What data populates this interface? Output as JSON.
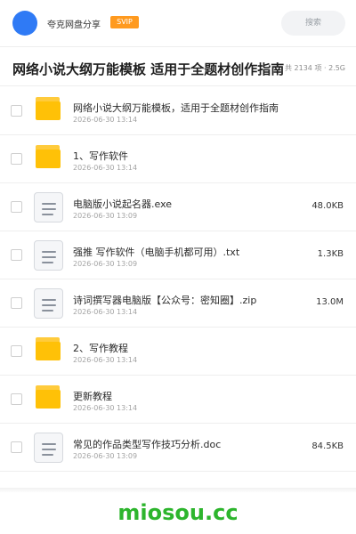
{
  "header": {
    "account_name": "夸克网盘分享",
    "badge": "SVIP",
    "search_placeholder": "搜索"
  },
  "page": {
    "title": "网络小说大纲万能模板 适用于全题材创作指南",
    "meta": "共 2134 项 · 2.5G"
  },
  "files": [
    {
      "type": "folder",
      "name": "网络小说大纲万能模板，适用于全题材创作指南",
      "date": "2026-06-30 13:14",
      "size": ""
    },
    {
      "type": "folder",
      "name": "1、写作软件",
      "date": "2026-06-30 13:14",
      "size": ""
    },
    {
      "type": "file",
      "name": "电脑版小说起名器.exe",
      "date": "2026-06-30 13:09",
      "size": "48.0KB"
    },
    {
      "type": "file",
      "name": "强推 写作软件（电脑手机都可用）.txt",
      "date": "2026-06-30 13:09",
      "size": "1.3KB"
    },
    {
      "type": "file",
      "name": "诗词撰写器电脑版【公众号：密知圈】.zip",
      "date": "2026-06-30 13:14",
      "size": "13.0M"
    },
    {
      "type": "folder",
      "name": "2、写作教程",
      "date": "2026-06-30 13:14",
      "size": ""
    },
    {
      "type": "folder",
      "name": "更新教程",
      "date": "2026-06-30 13:14",
      "size": ""
    },
    {
      "type": "file",
      "name": "常见的作品类型写作技巧分析.doc",
      "date": "2026-06-30 13:09",
      "size": "84.5KB"
    }
  ],
  "footer": {
    "brand": "miosou.cc"
  },
  "colors": {
    "accent": "#2f7af5",
    "badge": "#ff9a1f",
    "folder": "#ffc107",
    "brand_green": "#2db52d"
  },
  "icons": {
    "folder": "folder-icon",
    "file": "document-icon"
  }
}
